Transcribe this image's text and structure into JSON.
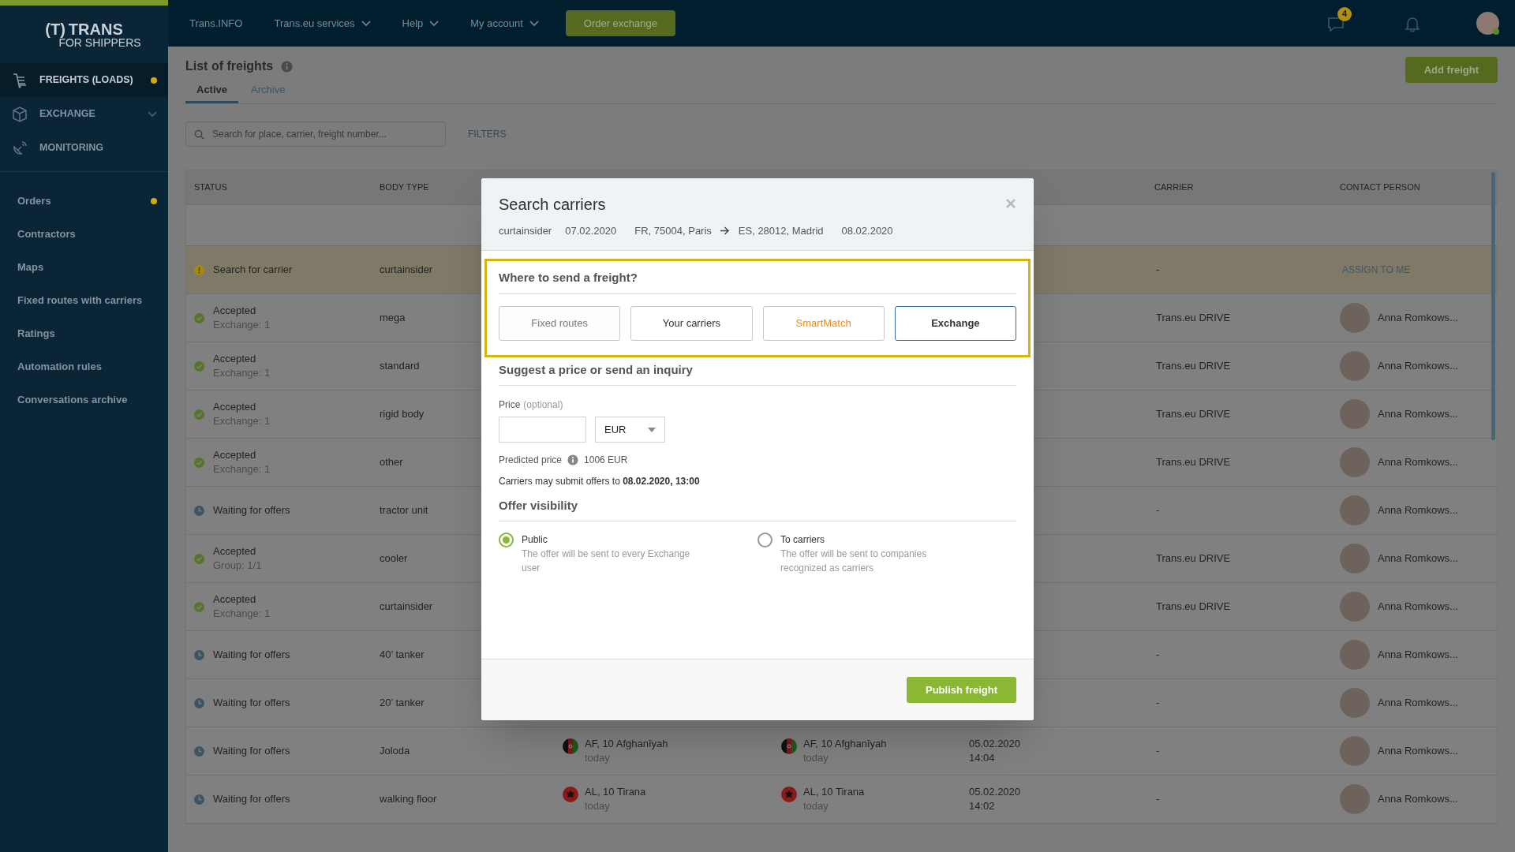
{
  "top_nav": {
    "logo": {
      "mark": "(T)",
      "brand": "TRANS",
      "sub": "FOR SHIPPERS"
    },
    "items": [
      {
        "label": "Trans.INFO",
        "has_dropdown": false
      },
      {
        "label": "Trans.eu services",
        "has_dropdown": true
      },
      {
        "label": "Help",
        "has_dropdown": true
      },
      {
        "label": "My account",
        "has_dropdown": true
      }
    ],
    "order_button": "Order exchange",
    "messages_badge": "4"
  },
  "sidebar": {
    "main_items": [
      {
        "label": "FREIGHTS (LOADS)",
        "selected": true,
        "dot": true,
        "chevron": false
      },
      {
        "label": "EXCHANGE",
        "selected": false,
        "dot": false,
        "chevron": true
      },
      {
        "label": "MONITORING",
        "selected": false,
        "dot": false,
        "chevron": false
      }
    ],
    "sub_items": [
      {
        "label": "Orders",
        "dot": true
      },
      {
        "label": "Contractors",
        "dot": false
      },
      {
        "label": "Maps",
        "dot": false
      },
      {
        "label": "Fixed routes with carriers",
        "dot": false
      },
      {
        "label": "Ratings",
        "dot": false
      },
      {
        "label": "Automation rules",
        "dot": false
      },
      {
        "label": "Conversations archive",
        "dot": false
      }
    ]
  },
  "page": {
    "title": "List of freights",
    "add_button": "Add freight",
    "tabs": [
      {
        "label": "Active",
        "selected": true
      },
      {
        "label": "Archive",
        "selected": false
      }
    ],
    "search": {
      "placeholder": "Search for place, carrier, freight number..."
    },
    "filters": "FILTERS"
  },
  "table": {
    "columns": {
      "status": "STATUS",
      "body_type": "BODY TYPE",
      "carrier": "CARRIER",
      "contact": "CONTACT PERSON"
    },
    "rows": [
      {
        "kind": "warning",
        "status_text": "Search for carrier",
        "body_type": "curtainsider",
        "carrier": "-",
        "assign_link": "ASSIGN TO ME",
        "highlighted": true
      },
      {
        "kind": "accepted",
        "status_text": "Accepted",
        "detail": "Exchange: 1",
        "body_type": "mega",
        "carrier": "Trans.eu DRIVE",
        "contact": "Anna Romkows...",
        "highlighted": false
      },
      {
        "kind": "accepted",
        "status_text": "Accepted",
        "detail": "Exchange: 1",
        "body_type": "standard",
        "carrier": "Trans.eu DRIVE",
        "contact": "Anna Romkows...",
        "highlighted": false
      },
      {
        "kind": "accepted",
        "status_text": "Accepted",
        "detail": "Exchange: 1",
        "body_type": "rigid body",
        "carrier": "Trans.eu DRIVE",
        "contact": "Anna Romkows...",
        "highlighted": false
      },
      {
        "kind": "accepted",
        "status_text": "Accepted",
        "detail": "Exchange: 1",
        "body_type": "other",
        "carrier": "Trans.eu DRIVE",
        "contact": "Anna Romkows...",
        "highlighted": false
      },
      {
        "kind": "waiting",
        "status_text": "Waiting for offers",
        "body_type": "tractor unit",
        "carrier": "-",
        "contact": "Anna Romkows...",
        "highlighted": false
      },
      {
        "kind": "accepted",
        "status_text": "Accepted",
        "detail": "Group: 1/1",
        "body_type": "cooler",
        "carrier": "Trans.eu DRIVE",
        "contact": "Anna Romkows...",
        "highlighted": false
      },
      {
        "kind": "accepted",
        "status_text": "Accepted",
        "detail": "Exchange: 1",
        "body_type": "curtainsider",
        "carrier": "Trans.eu DRIVE",
        "contact": "Anna Romkows...",
        "highlighted": false
      },
      {
        "kind": "waiting",
        "status_text": "Waiting for offers",
        "body_type": "40’ tanker",
        "carrier": "-",
        "contact": "Anna Romkows...",
        "highlighted": false
      },
      {
        "kind": "waiting",
        "status_text": "Waiting for offers",
        "body_type": "20’ tanker",
        "carrier": "-",
        "contact": "Anna Romkows...",
        "highlighted": false
      },
      {
        "kind": "waiting",
        "status_text": "Waiting for offers",
        "body_type": "Joloda",
        "loading": {
          "kind": "af",
          "place": "AF, 10 Afghanīyah",
          "when": "today"
        },
        "unloading": {
          "kind": "af",
          "place": "AF, 10 Afghanīyah",
          "when": "today"
        },
        "date": "05.02.2020",
        "time": "14:04",
        "carrier": "-",
        "contact": "Anna Romkows...",
        "highlighted": false
      },
      {
        "kind": "waiting",
        "status_text": "Waiting for offers",
        "body_type": "walking floor",
        "loading": {
          "kind": "al",
          "place": "AL, 10 Tirana",
          "when": "today"
        },
        "unloading": {
          "kind": "al",
          "place": "AL, 10 Tirana",
          "when": "today"
        },
        "date": "05.02.2020",
        "time": "14:02",
        "carrier": "-",
        "contact": "Anna Romkows...",
        "highlighted": false
      }
    ]
  },
  "modal": {
    "title": "Search carriers",
    "meta": {
      "body_type": "curtainsider",
      "load_date": "07.02.2020",
      "from": "FR, 75004, Paris",
      "to": "ES, 28012, Madrid",
      "unload_date": "08.02.2020"
    },
    "send_heading": "Where to send a freight?",
    "send_options": [
      {
        "label": "Fixed routes",
        "selected": false,
        "disabled": true,
        "accent": false
      },
      {
        "label": "Your carriers",
        "selected": false,
        "disabled": false,
        "accent": false
      },
      {
        "label": "SmartMatch",
        "selected": false,
        "disabled": false,
        "accent": true
      },
      {
        "label": "Exchange",
        "selected": true,
        "disabled": false,
        "accent": false
      }
    ],
    "price_heading": "Suggest a price or send an inquiry",
    "price_label": "Price",
    "price_hint": "(optional)",
    "currency": "EUR",
    "predicted_label": "Predicted price",
    "predicted_value": "1006 EUR",
    "deadline": "Carriers may submit offers to **08.02.2020, 13:00**",
    "visibility_heading": "Offer visibility",
    "visibility": [
      {
        "label": "Public",
        "description": "The offer will be sent to every Exchange user",
        "selected": true
      },
      {
        "label": "To carriers",
        "description": "The offer will be sent to companies recognized as carriers",
        "selected": false
      }
    ],
    "publish_button": "Publish freight"
  }
}
